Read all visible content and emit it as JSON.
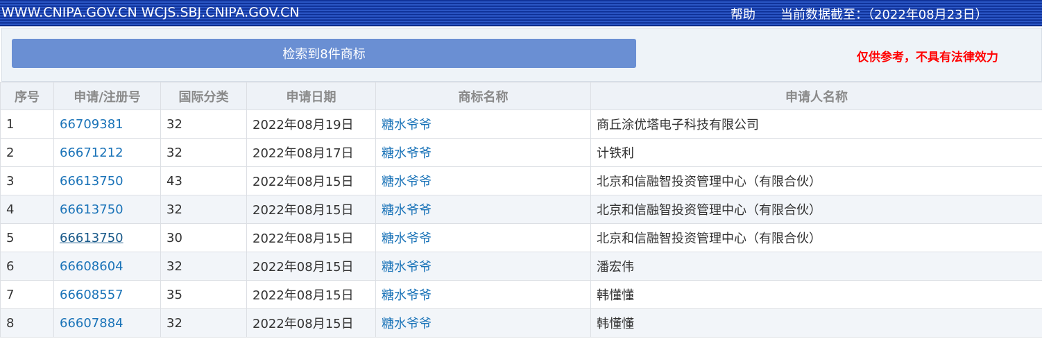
{
  "header": {
    "site": "WWW.CNIPA.GOV.CN WCJS.SBJ.CNIPA.GOV.CN",
    "help": "帮助",
    "cutoff": "当前数据截至：（2022年08月23日）"
  },
  "panel": {
    "result_button": "检索到8件商标",
    "disclaimer": "仅供参考，不具有法律效力"
  },
  "table": {
    "headers": [
      "序号",
      "申请/注册号",
      "国际分类",
      "申请日期",
      "商标名称",
      "申请人名称"
    ],
    "rows": [
      {
        "no": "1",
        "reg": "66709381",
        "cls": "32",
        "date": "2022年08月19日",
        "name": "糖水爷爷",
        "applicant": "商丘涂优塔电子科技有限公司"
      },
      {
        "no": "2",
        "reg": "66671212",
        "cls": "32",
        "date": "2022年08月17日",
        "name": "糖水爷爷",
        "applicant": "计铁利"
      },
      {
        "no": "3",
        "reg": "66613750",
        "cls": "43",
        "date": "2022年08月15日",
        "name": "糖水爷爷",
        "applicant": "北京和信融智投资管理中心（有限合伙）"
      },
      {
        "no": "4",
        "reg": "66613750",
        "cls": "32",
        "date": "2022年08月15日",
        "name": "糖水爷爷",
        "applicant": "北京和信融智投资管理中心（有限合伙）"
      },
      {
        "no": "5",
        "reg": "66613750",
        "cls": "30",
        "date": "2022年08月15日",
        "name": "糖水爷爷",
        "applicant": "北京和信融智投资管理中心（有限合伙）"
      },
      {
        "no": "6",
        "reg": "66608604",
        "cls": "32",
        "date": "2022年08月15日",
        "name": "糖水爷爷",
        "applicant": "潘宏伟"
      },
      {
        "no": "7",
        "reg": "66608557",
        "cls": "35",
        "date": "2022年08月15日",
        "name": "糖水爷爷",
        "applicant": "韩懂懂"
      },
      {
        "no": "8",
        "reg": "66607884",
        "cls": "32",
        "date": "2022年08月15日",
        "name": "糖水爷爷",
        "applicant": "韩懂懂"
      }
    ]
  },
  "colors": {
    "link": "#1a73b8",
    "disclaimer": "#ff0000",
    "result_button": "#6a8fd3",
    "topbar": "#2a55c4"
  }
}
